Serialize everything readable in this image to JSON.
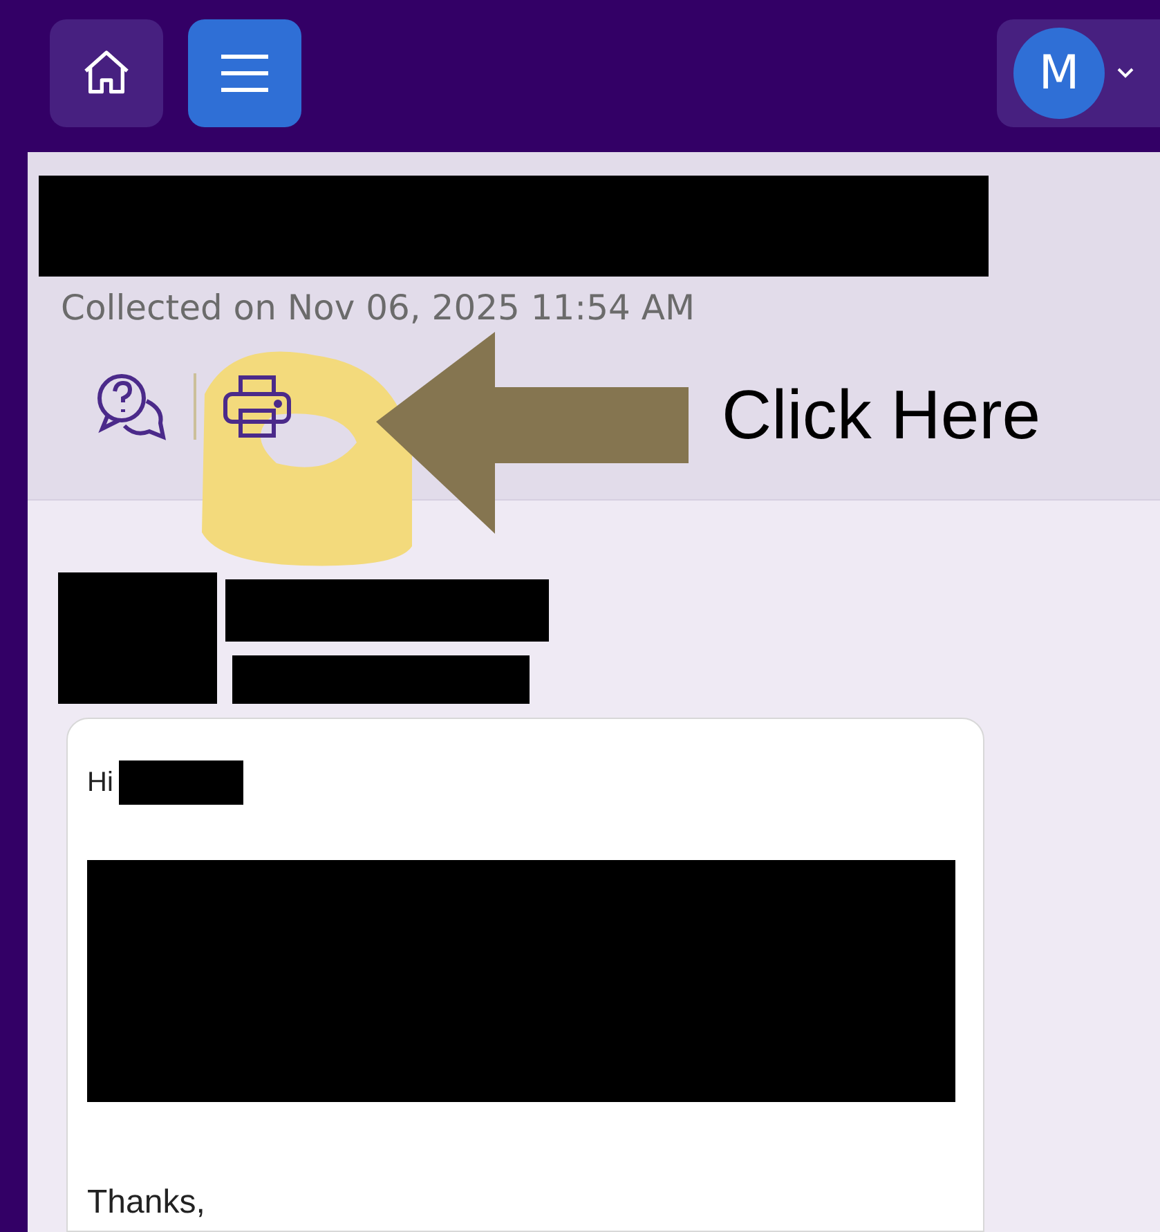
{
  "top_bar": {
    "avatar_letter": "M"
  },
  "header": {
    "collected": "Collected on Nov 06, 2025 11:54 AM"
  },
  "annotation": {
    "label": "Click Here"
  },
  "message": {
    "greeting": "Hi",
    "closing": "Thanks,"
  }
}
